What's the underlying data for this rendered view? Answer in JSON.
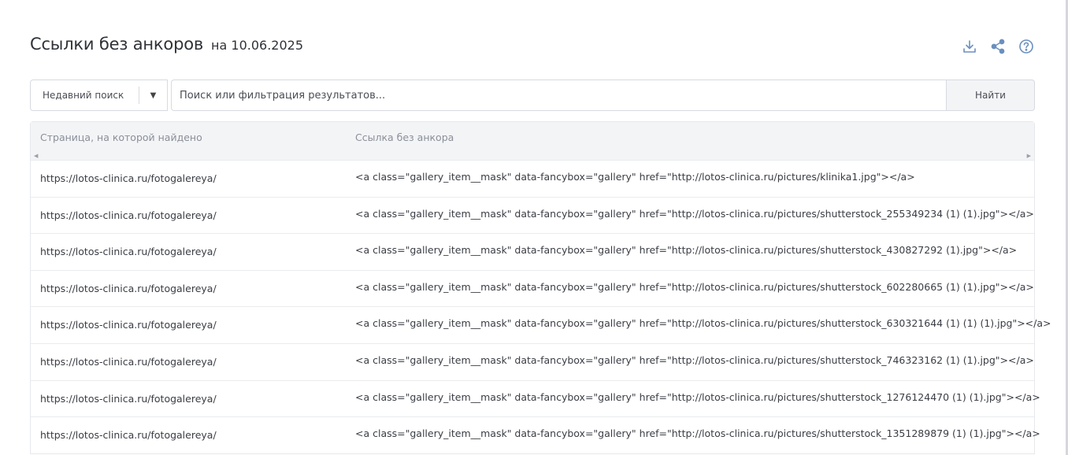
{
  "header": {
    "title": "Ссылки без анкоров",
    "date": "на 10.06.2025"
  },
  "toolbar": {
    "icons": [
      "download-icon",
      "share-icon",
      "help-icon"
    ],
    "accent": "#6b8fbf"
  },
  "search": {
    "recent_label": "Недавний поиск",
    "placeholder": "Поиск или фильтрация результатов...",
    "button_label": "Найти"
  },
  "table": {
    "columns": [
      "Страница, на которой найдено",
      "Ссылка без анкора"
    ],
    "rows": [
      {
        "page": "https://lotos-clinica.ru/fotogalereya/",
        "link": "<a class=\"gallery_item__mask\" data-fancybox=\"gallery\" href=\"http://lotos-clinica.ru/pictures/klinika1.jpg\"></a>"
      },
      {
        "page": "https://lotos-clinica.ru/fotogalereya/",
        "link": "<a class=\"gallery_item__mask\" data-fancybox=\"gallery\" href=\"http://lotos-clinica.ru/pictures/shutterstock_255349234 (1) (1).jpg\"></a>"
      },
      {
        "page": "https://lotos-clinica.ru/fotogalereya/",
        "link": "<a class=\"gallery_item__mask\" data-fancybox=\"gallery\" href=\"http://lotos-clinica.ru/pictures/shutterstock_430827292 (1).jpg\"></a>"
      },
      {
        "page": "https://lotos-clinica.ru/fotogalereya/",
        "link": "<a class=\"gallery_item__mask\" data-fancybox=\"gallery\" href=\"http://lotos-clinica.ru/pictures/shutterstock_602280665 (1) (1).jpg\"></a>"
      },
      {
        "page": "https://lotos-clinica.ru/fotogalereya/",
        "link": "<a class=\"gallery_item__mask\" data-fancybox=\"gallery\" href=\"http://lotos-clinica.ru/pictures/shutterstock_630321644 (1) (1) (1).jpg\"></a>"
      },
      {
        "page": "https://lotos-clinica.ru/fotogalereya/",
        "link": "<a class=\"gallery_item__mask\" data-fancybox=\"gallery\" href=\"http://lotos-clinica.ru/pictures/shutterstock_746323162 (1) (1).jpg\"></a>"
      },
      {
        "page": "https://lotos-clinica.ru/fotogalereya/",
        "link": "<a class=\"gallery_item__mask\" data-fancybox=\"gallery\" href=\"http://lotos-clinica.ru/pictures/shutterstock_1276124470 (1) (1).jpg\"></a>"
      },
      {
        "page": "https://lotos-clinica.ru/fotogalereya/",
        "link": "<a class=\"gallery_item__mask\" data-fancybox=\"gallery\" href=\"http://lotos-clinica.ru/pictures/shutterstock_1351289879 (1) (1).jpg\"></a>"
      }
    ]
  }
}
